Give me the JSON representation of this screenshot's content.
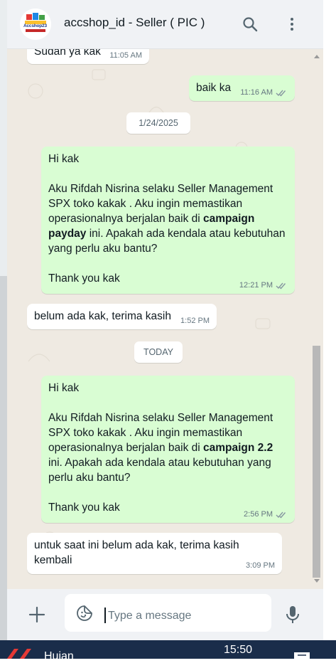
{
  "header": {
    "title": "accshop_id - Seller ( PIC )",
    "avatar_text": "Accshop23",
    "icons": [
      "search-icon",
      "more-vert-icon"
    ]
  },
  "messages": [
    {
      "type": "in",
      "text": "Sudah ya kak",
      "time": "11:05 AM"
    },
    {
      "type": "out",
      "text": "baik ka",
      "time": "11:16 AM"
    },
    {
      "type": "date",
      "text": "1/24/2025"
    },
    {
      "type": "out",
      "time": "12:21 PM",
      "line1": "Hi kak",
      "line2": "Aku Rifdah Nisrina selaku Seller Management",
      "line3": "SPX toko kakak . Aku ingin memastikan",
      "line4_pre": "operasionalnya berjalan baik di ",
      "line4_bold": "campaign",
      "line5_bold": "payday",
      "line5_post": " ini. Apakah ada kendala atau kebutuhan",
      "line6": "yang perlu aku bantu?",
      "line7": "Thank you kak"
    },
    {
      "type": "in",
      "text": "belum ada kak, terima kasih",
      "time": "1:52 PM"
    },
    {
      "type": "date",
      "text": "TODAY"
    },
    {
      "type": "out",
      "time": "2:56 PM",
      "line1": "Hi kak",
      "line2": "Aku Rifdah Nisrina selaku Seller Management",
      "line3": "SPX toko kakak . Aku ingin memastikan",
      "line4_pre": "operasionalnya berjalan baik di ",
      "line4_bold": "campaign 2.2",
      "line5": "ini. Apakah ada kendala atau kebutuhan yang",
      "line6": "perlu aku bantu?",
      "line7": "Thank you kak"
    },
    {
      "type": "in",
      "line1": "untuk saat ini belum ada kak, terima kasih",
      "line2": "kembali",
      "time": "3:09 PM"
    }
  ],
  "composer": {
    "placeholder": "Type a message",
    "icons": [
      "plus-icon",
      "sticker-icon",
      "mic-icon"
    ]
  },
  "taskbar": {
    "clock": "15:50",
    "label": "Hujan"
  },
  "colors": {
    "chat_bg": "#efeae2",
    "outgoing": "#d9fdd3",
    "incoming": "#ffffff",
    "read_ticks": "#8696a0",
    "taskbar": "#1a2d4a"
  }
}
